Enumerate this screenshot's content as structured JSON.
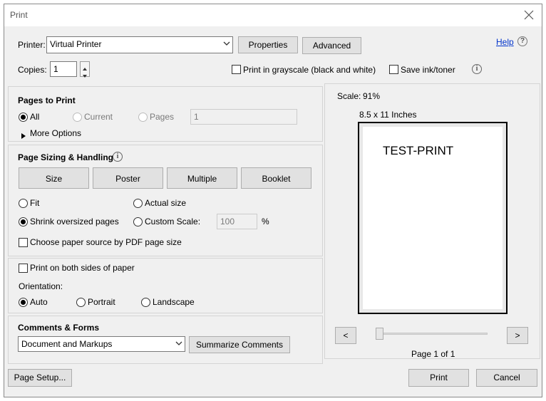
{
  "window": {
    "title": "Print"
  },
  "printer": {
    "label": "Printer:",
    "selected": "Virtual Printer",
    "properties_label": "Properties",
    "advanced_label": "Advanced",
    "help_label": "Help"
  },
  "copies": {
    "label": "Copies:",
    "value": "1"
  },
  "options": {
    "grayscale_label": "Print in grayscale (black and white)",
    "save_ink_label": "Save ink/toner"
  },
  "pages_to_print": {
    "heading": "Pages to Print",
    "all_label": "All",
    "current_label": "Current",
    "pages_label": "Pages",
    "pages_value": "1",
    "more_options_label": "More Options"
  },
  "sizing": {
    "heading": "Page Sizing & Handling",
    "size_label": "Size",
    "poster_label": "Poster",
    "multiple_label": "Multiple",
    "booklet_label": "Booklet",
    "fit_label": "Fit",
    "actual_size_label": "Actual size",
    "shrink_label": "Shrink oversized pages",
    "custom_scale_label": "Custom Scale:",
    "custom_scale_value": "100",
    "percent_label": "%",
    "paper_source_label": "Choose paper source by PDF page size"
  },
  "duplex": {
    "both_sides_label": "Print on both sides of paper"
  },
  "orientation": {
    "label": "Orientation:",
    "auto_label": "Auto",
    "portrait_label": "Portrait",
    "landscape_label": "Landscape"
  },
  "comments": {
    "heading": "Comments & Forms",
    "selected": "Document and Markups",
    "summarize_label": "Summarize Comments"
  },
  "preview": {
    "scale_label": "Scale:",
    "scale_value": "91%",
    "paper_size": "8.5 x 11 Inches",
    "page_text": "TEST-PRINT",
    "prev_label": "<",
    "next_label": ">",
    "page_indicator": "Page 1 of 1",
    "slider_position": 0
  },
  "footer": {
    "page_setup_label": "Page Setup...",
    "print_label": "Print",
    "cancel_label": "Cancel"
  }
}
